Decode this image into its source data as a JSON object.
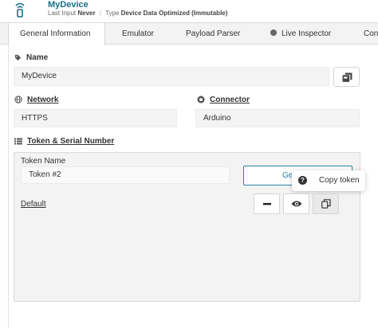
{
  "header": {
    "device_name": "MyDevice",
    "last_input_label": "Last Input",
    "last_input_value": "Never",
    "type_label": "Type",
    "type_value": "Device Data Optimized (Immutable)"
  },
  "tabs": [
    {
      "label": "General Information",
      "active": true
    },
    {
      "label": "Emulator",
      "active": false
    },
    {
      "label": "Payload Parser",
      "active": false
    },
    {
      "label": "Live Inspector",
      "active": false
    },
    {
      "label": "Con",
      "active": false
    }
  ],
  "name_section": {
    "label": "Name",
    "value": "MyDevice",
    "icon": "tag-icon",
    "action_icon": "save-icon"
  },
  "network_section": {
    "label": "Network",
    "value": "HTTPS",
    "icon": "globe-icon"
  },
  "connector_section": {
    "label": "Connector",
    "value": "Arduino",
    "icon": "connector-icon"
  },
  "token_section": {
    "label": "Token & Serial Number",
    "icon": "list-icon",
    "token_name_label": "Token Name",
    "token_name_value": "Token #2",
    "generate_button_label": "Ge",
    "default_link": "Default",
    "tooltip_text": "Copy token"
  },
  "colors": {
    "accent": "#2f7fa6",
    "device_name": "#1b6f84",
    "field_bg": "#f4f4f4",
    "tab_bg": "#f3f3f3"
  }
}
